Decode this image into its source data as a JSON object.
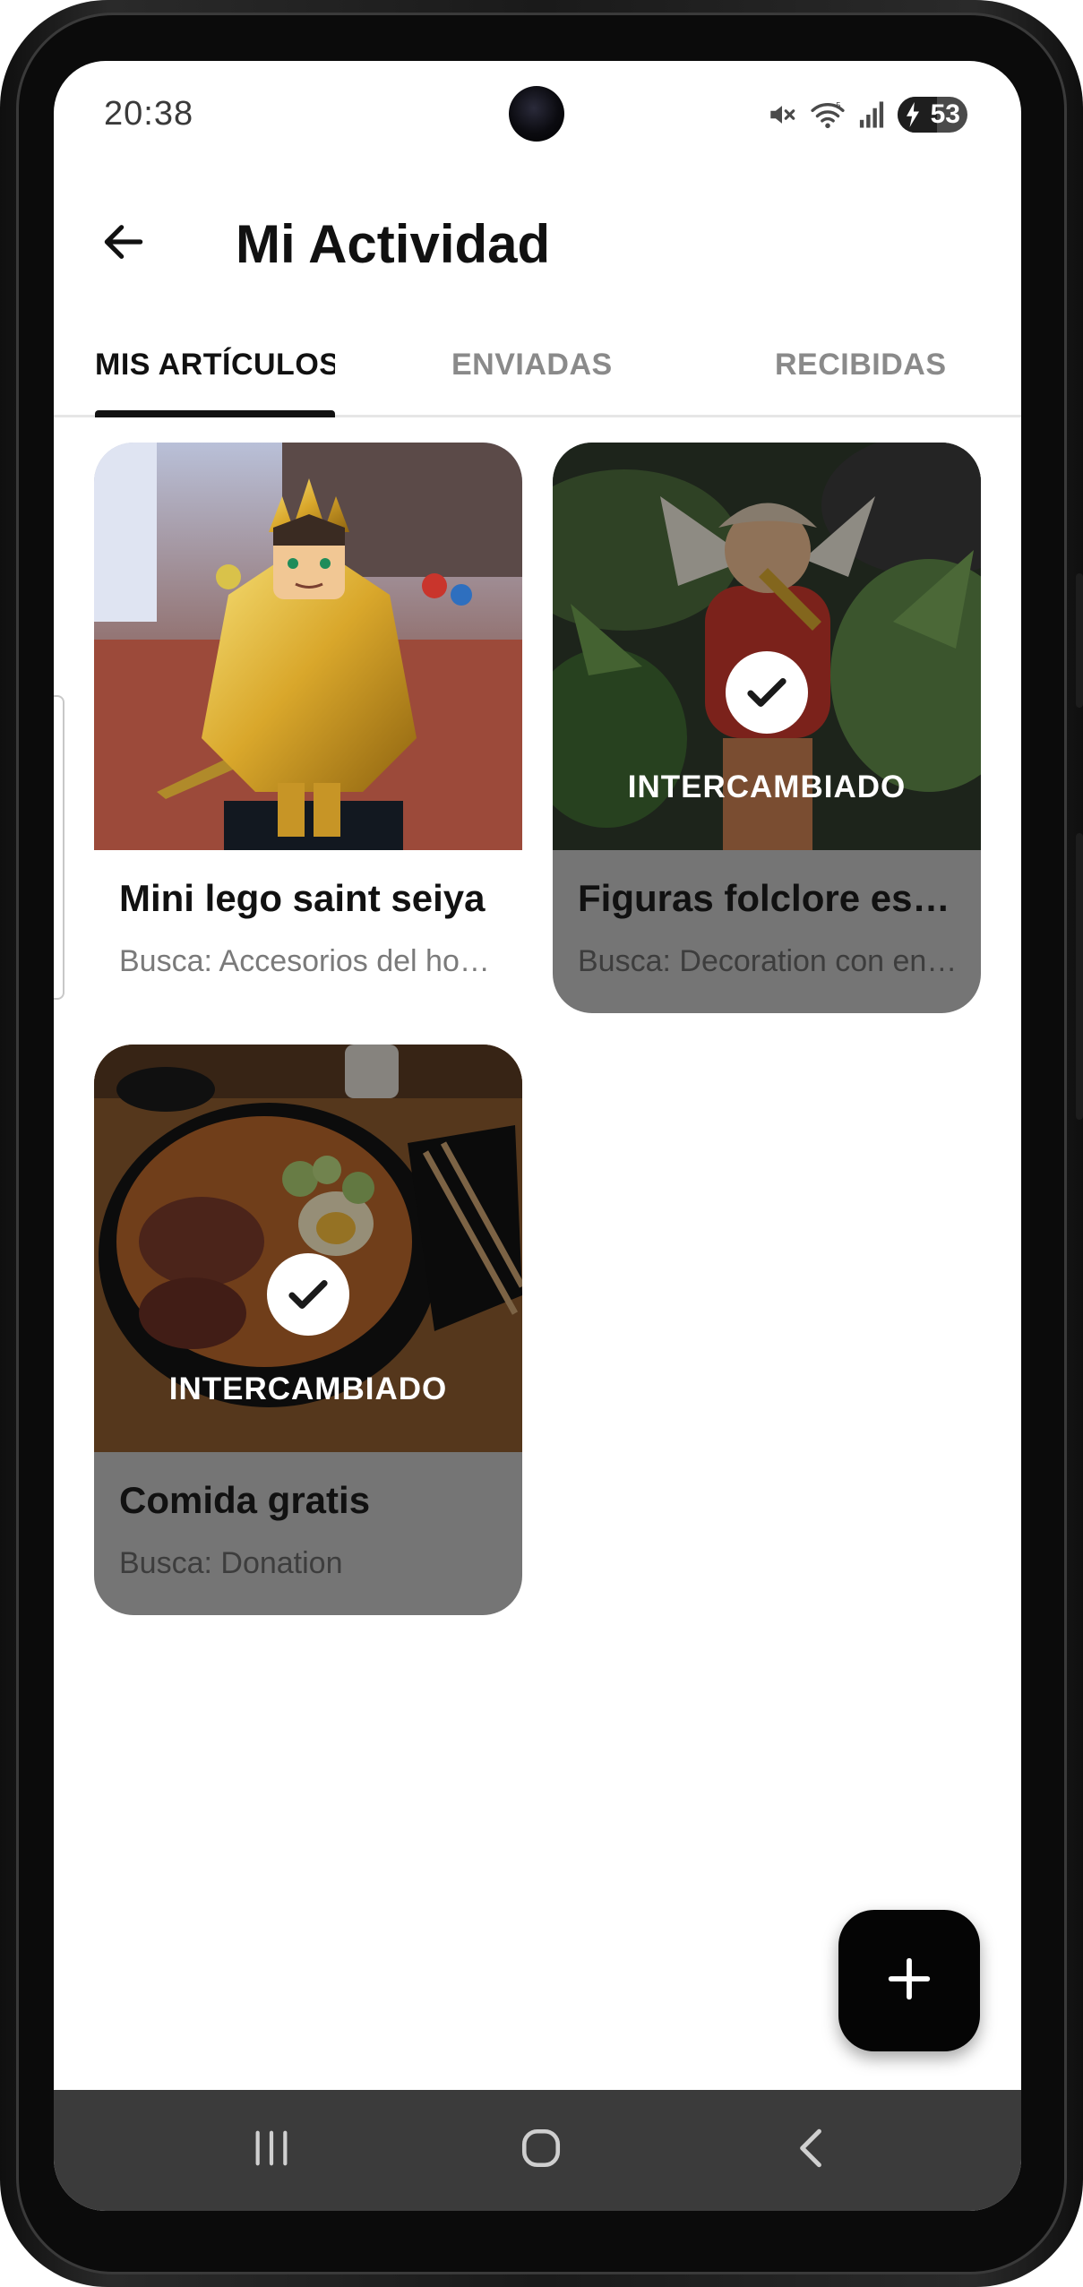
{
  "status_bar": {
    "time": "20:38",
    "battery_level": "53",
    "icons": [
      "mute-icon",
      "wifi-icon",
      "signal-icon",
      "battery-charging-icon"
    ]
  },
  "app_bar": {
    "back_icon": "arrow-left-icon",
    "title": "Mi Actividad"
  },
  "tabs": [
    {
      "label": "MIS ARTÍCULOS",
      "active": true
    },
    {
      "label": "ENVIADAS",
      "active": false
    },
    {
      "label": "RECIBIDAS",
      "active": false
    }
  ],
  "items": [
    {
      "title": "Mini lego saint seiya",
      "subtitle": "Busca: Accesorios del hogar",
      "status": ""
    },
    {
      "title": "Figuras folclore español",
      "subtitle": "Busca: Decoration con encanto",
      "status": "INTERCAMBIADO"
    },
    {
      "title": "Comida gratis",
      "subtitle": "Busca: Donation",
      "status": "INTERCAMBIADO"
    }
  ],
  "fab": {
    "icon": "plus-icon"
  },
  "nav_bar": {
    "icons": [
      "recents-icon",
      "home-icon",
      "back-icon"
    ]
  },
  "colors": {
    "accent": "#111111",
    "exchanged_card": "#757575",
    "nav_bar": "#3b3b3b"
  }
}
